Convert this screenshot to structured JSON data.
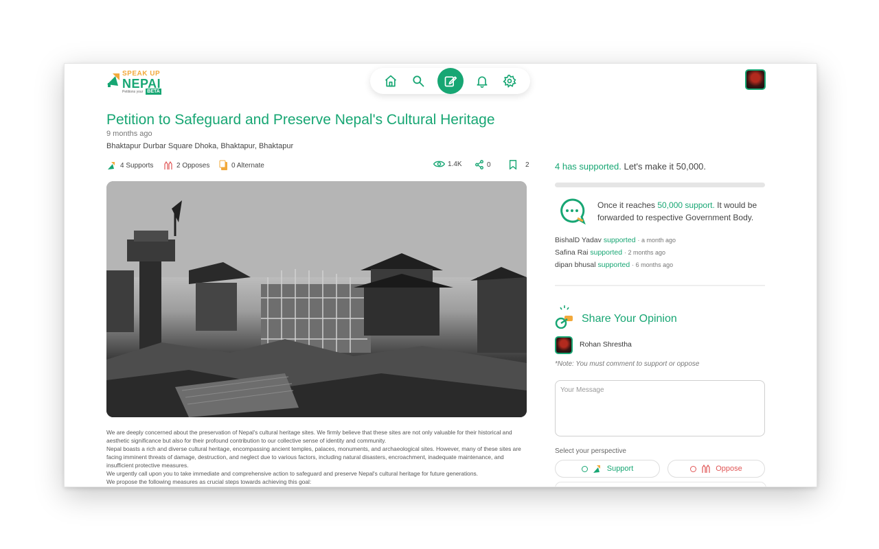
{
  "header": {
    "logo": {
      "top": "SPEAK UP",
      "main": "NEPAI",
      "sub": "Petitions your",
      "badge": "BETA"
    },
    "nav": [
      {
        "name": "home-icon"
      },
      {
        "name": "search-icon"
      },
      {
        "name": "edit-icon",
        "active": true
      },
      {
        "name": "bell-icon"
      },
      {
        "name": "gear-icon"
      }
    ]
  },
  "petition": {
    "title": "Petition to Safeguard and Preserve Nepal's Cultural Heritage",
    "time": "9 months ago",
    "location": "Bhaktapur Durbar Square Dhoka, Bhaktapur, Bhaktapur",
    "supports_label": "4 Supports",
    "opposes_label": "2 Opposes",
    "alternate_label": "0 Alternate",
    "views": "1.4K",
    "shares": "0",
    "bookmarks": "2",
    "body": [
      "We are deeply concerned about the preservation of Nepal's cultural heritage sites. We firmly believe that these sites are not only valuable for their historical and aesthetic significance but also for their profound contribution to our collective sense of identity and community.",
      "Nepal boasts a rich and diverse cultural heritage, encompassing ancient temples, palaces, monuments, and archaeological sites. However, many of these sites are facing imminent threats of damage, destruction, and neglect due to various factors, including natural disasters, encroachment, inadequate maintenance, and insufficient protective measures.",
      "We urgently call upon you to take immediate and comprehensive action to safeguard and preserve Nepal's cultural heritage for future generations.",
      "We propose the following measures as crucial steps towards achieving this goal:"
    ]
  },
  "sidebar": {
    "goal_count": "4 has supported.",
    "goal_rest": " Let's make it 50,000.",
    "progress": 8e-05,
    "note_a": "Once it reaches ",
    "note_b": "50,000 support.",
    "note_c": " It would be forwarded to respective Government Body.",
    "supporters": [
      {
        "name": "BishalD Yadav",
        "action": "supported",
        "ago": "· a month ago"
      },
      {
        "name": "Safina Rai",
        "action": "supported",
        "ago": "· 2 months ago"
      },
      {
        "name": "dipan bhusal",
        "action": "supported",
        "ago": "· 6 months ago"
      }
    ],
    "opinion_title": "Share Your Opinion",
    "author": "Rohan Shrestha",
    "note": "*Note: You must comment to support or oppose",
    "message_placeholder": "Your Message",
    "perspective_label": "Select your perspective",
    "support_label": "Support",
    "oppose_label": "Oppose"
  },
  "colors": {
    "accent": "#17a673",
    "secondary": "#f2a93b",
    "danger": "#e05555"
  }
}
